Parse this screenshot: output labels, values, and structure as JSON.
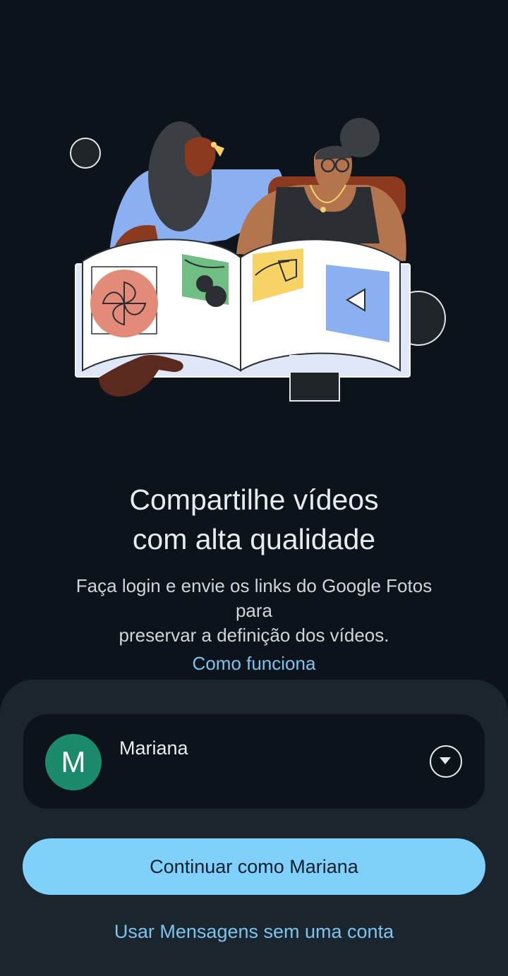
{
  "onboarding": {
    "illustration_icon": "photo-book-illustration",
    "title_line1": "Compartilhe vídeos",
    "title_line2": "com alta qualidade",
    "subtitle_line1": "Faça login e envie os links do Google Fotos",
    "subtitle_line2": "para",
    "subtitle_line3": "preservar a definição dos vídeos.",
    "how_it_works_link": "Como funciona"
  },
  "account": {
    "avatar_initial": "M",
    "avatar_color": "#1b8a6b",
    "name": "Mariana",
    "dropdown_icon": "chevron-down-icon"
  },
  "actions": {
    "continue_label": "Continuar como Mariana",
    "no_account_label": "Usar Mensagens sem uma conta",
    "accent_color": "#7fd0fb"
  }
}
